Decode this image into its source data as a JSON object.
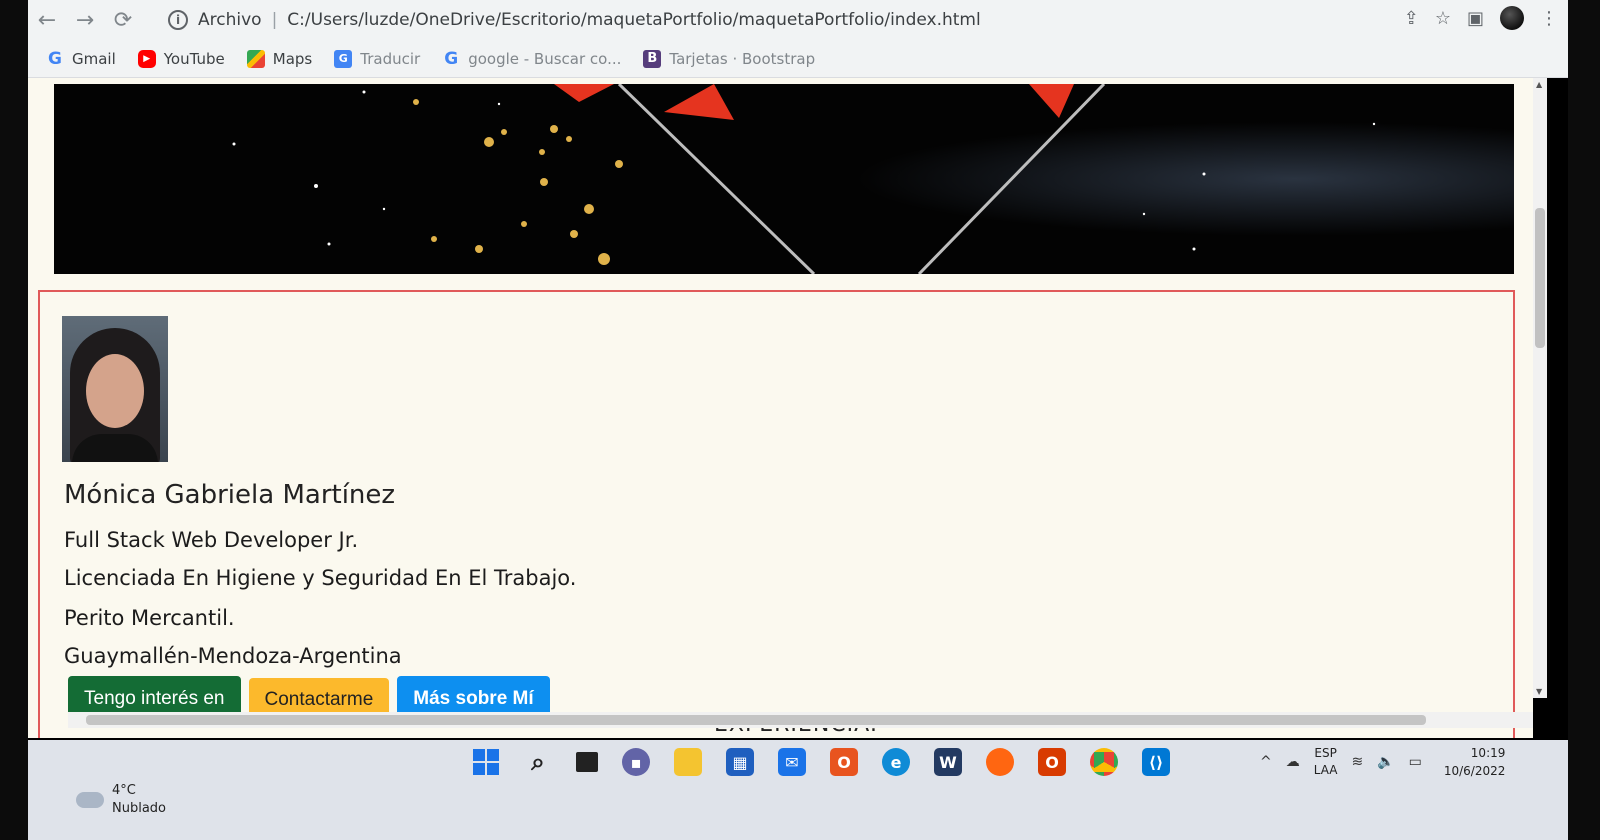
{
  "browser": {
    "info_label": "Archivo",
    "url": "C:/Users/luzde/OneDrive/Escritorio/maquetaPortfolio/maquetaPortfolio/index.html"
  },
  "bookmarks": [
    {
      "label": "Gmail",
      "icon": "google-icon"
    },
    {
      "label": "YouTube",
      "icon": "youtube-icon"
    },
    {
      "label": "Maps",
      "icon": "maps-icon"
    },
    {
      "label": "Traducir",
      "icon": "translate-icon"
    },
    {
      "label": "google - Buscar co...",
      "icon": "google-icon"
    },
    {
      "label": "Tarjetas · Bootstrap",
      "icon": "bootstrap-icon"
    }
  ],
  "profile": {
    "name": "Mónica Gabriela Martínez",
    "role": "Full Stack Web Developer Jr.",
    "degree": "Licenciada En Higiene y Seguridad En El Trabajo.",
    "perito": "Perito Mercantil.",
    "location": "Guaymallén-Mendoza-Argentina"
  },
  "buttons": {
    "interest": "Tengo interés en",
    "contact": "Contactarme",
    "more": "Más sobre Mí"
  },
  "section": {
    "experience": "EXPERIENCIA:"
  },
  "taskbar": {
    "weather_temp": "4°C",
    "weather_desc": "Nublado",
    "lang_1": "ESP",
    "lang_2": "LAA",
    "time": "10:19",
    "date": "10/6/2022"
  },
  "colors": {
    "card_border": "#e05a5a",
    "btn_interest": "#146c35",
    "btn_contact": "#fcb92c",
    "btn_more": "#0d8ff0"
  }
}
